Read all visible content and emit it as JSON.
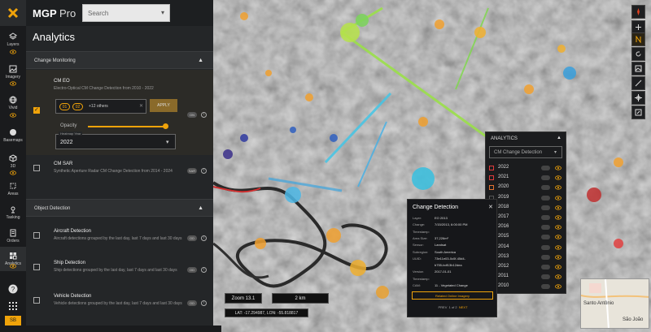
{
  "app": {
    "brand": "MGP",
    "brand_suffix": "Pro"
  },
  "search": {
    "placeholder": "Search"
  },
  "rail": {
    "items": [
      {
        "label": "Layers",
        "icon": "layers-icon"
      },
      {
        "label": "Imagery",
        "icon": "imagery-icon"
      },
      {
        "label": "Vivid",
        "icon": "globe-icon"
      },
      {
        "label": "Basemaps",
        "icon": "basemaps-icon"
      },
      {
        "label": "3D",
        "icon": "cube-icon"
      },
      {
        "label": "Areas",
        "icon": "areas-icon"
      },
      {
        "label": "Tasking",
        "icon": "tasking-icon"
      },
      {
        "label": "Orders",
        "icon": "orders-icon"
      },
      {
        "label": "Analytics",
        "icon": "analytics-icon"
      }
    ],
    "user_initials": "SB"
  },
  "panel": {
    "title": "Analytics",
    "sections": [
      {
        "label": "Change Monitoring"
      },
      {
        "label": "Object Detection"
      }
    ],
    "cm_eo": {
      "title": "CM EO",
      "desc": "Electro-Optical CM Change Detection from 2010 - 2022",
      "chips": [
        "01",
        "02"
      ],
      "more": "+12 others",
      "apply": "APPLY",
      "opacity_label": "Opacity",
      "opacity": 0.95,
      "year_label": "Heatmap Year",
      "year": "2022",
      "pill": "ON"
    },
    "cm_sar": {
      "title": "CM SAR",
      "desc": "Synthetic Aperture Radar CM Change Detection from 2014 - 2024",
      "pill": "SAR"
    },
    "aircraft": {
      "title": "Aircraft Detection",
      "desc": "Aircraft detections grouped by the last day, last 7 days and last 30 days",
      "pill": "OD"
    },
    "ship": {
      "title": "Ship Detection",
      "desc": "Ship detections grouped by the last day, last 7 days and last 30 days",
      "pill": "OD"
    },
    "vehicle": {
      "title": "Vehicle Detection",
      "desc": "Vehicle detections grouped by the last day, last 7 days and last 30 days",
      "pill": "OD"
    }
  },
  "legend": {
    "title": "ANALYTICS",
    "select": "CM Change Detection",
    "years": [
      "2022",
      "2021",
      "2020",
      "2019",
      "2018",
      "2017",
      "2016",
      "2015",
      "2014",
      "2013",
      "2012",
      "2011",
      "2010"
    ],
    "color": "#e03a3a"
  },
  "popup": {
    "title": "Change Detection",
    "rows": [
      {
        "k": "Layer:",
        "v": "EO 2013"
      },
      {
        "k": "Change:",
        "v": "7/15/2013, 6:00:00 PM"
      },
      {
        "k": "Timestamp:",
        "v": ""
      },
      {
        "k": "Area Size:",
        "v": "37,226m²"
      },
      {
        "k": "Sensor:",
        "v": "Landsat"
      },
      {
        "k": "Subregion:",
        "v": "South America"
      },
      {
        "k": "UUID:",
        "v": "73e11e03-0c0f-45d4-"
      },
      {
        "k": "",
        "v": "b755-bdf13b12dea"
      },
      {
        "k": "Version",
        "v": "2017-01-01"
      },
      {
        "k": "Timestamp:",
        "v": ""
      },
      {
        "k": "CAM:",
        "v": "11 - Vegetated Change"
      }
    ],
    "button": "Related Online Imagery",
    "page": "1 of 2",
    "prev": "PREV",
    "next": "NEXT"
  },
  "map": {
    "zoom": "Zoom 13.1",
    "scale": "2 km",
    "coords": "LAT: -17.294987, LON: -55.818817",
    "minimap_labels": [
      "Santo Antônio",
      "São João"
    ]
  },
  "colors": {
    "accent": "#f0a30a",
    "panel": "#242628",
    "rail": "#1a1b1d"
  }
}
